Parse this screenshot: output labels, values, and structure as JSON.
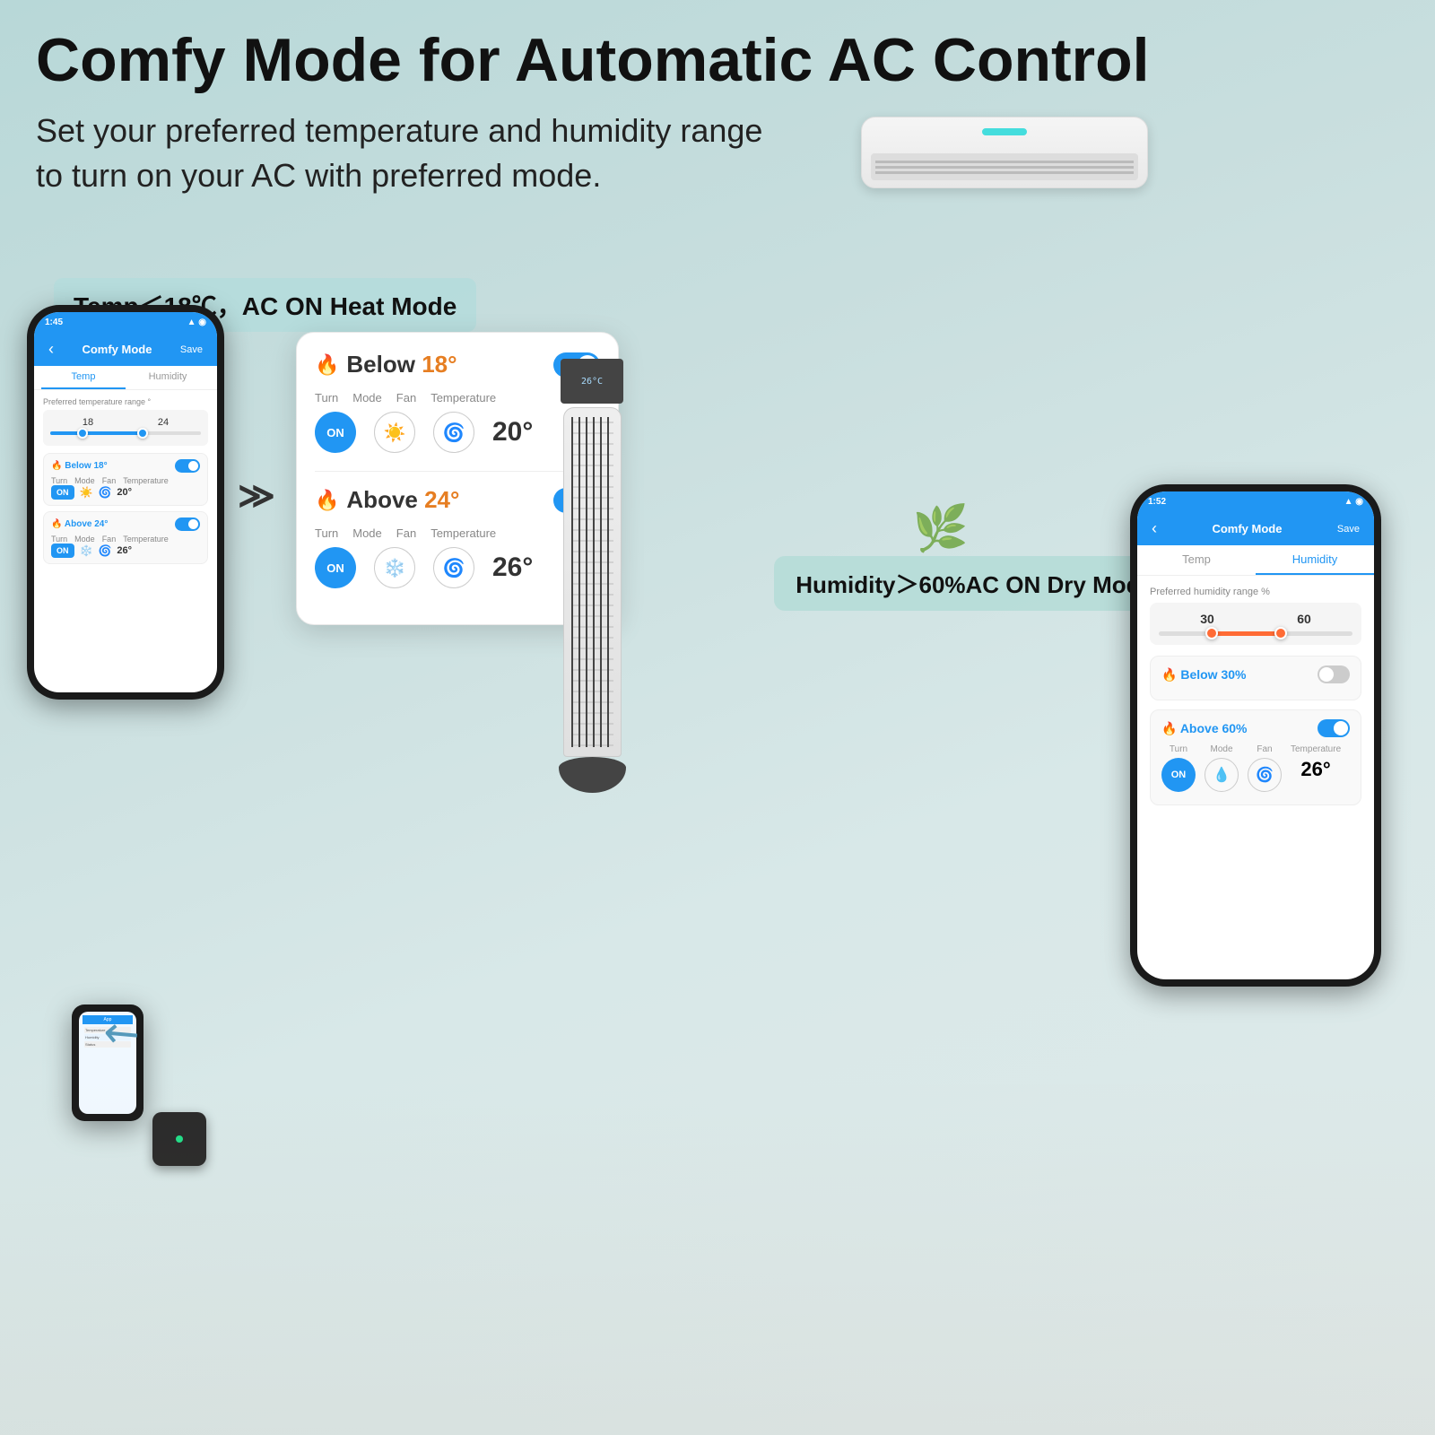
{
  "page": {
    "title": "Comfy Mode for Automatic AC Control",
    "subtitle_line1": "Set your preferred temperature and humidity range",
    "subtitle_line2": "to turn on your AC with preferred mode.",
    "temp_label": "Temp＜18℃，AC ON Heat Mode",
    "humidity_label": "Humidity＞60%AC ON Dry Mode"
  },
  "left_phone": {
    "time": "1:45",
    "nav_title": "Comfy Mode",
    "nav_save": "Save",
    "tab_temp": "Temp",
    "tab_humidity": "Humidity",
    "range_label": "Preferred temperature range °",
    "range_val1": "18",
    "range_val2": "24",
    "below_title": "Below 18°",
    "below_color": "#e67e22",
    "above_title": "Above 24°",
    "above_color": "#e67e22",
    "turn_label": "Turn",
    "mode_label": "Mode",
    "fan_label": "Fan",
    "temp_label": "Temperature",
    "below_temp": "20°",
    "above_temp": "26°",
    "btn_on": "ON"
  },
  "center_card": {
    "below_title": "Below",
    "below_value": "18°",
    "above_title": "Above",
    "above_value": "24°",
    "turn_label": "Turn",
    "mode_label": "Mode",
    "fan_label": "Fan",
    "temp_label": "Temperature",
    "below_temp": "20°",
    "above_temp": "26°",
    "btn_on": "ON"
  },
  "right_phone": {
    "time": "1:52",
    "nav_title": "Comfy Mode",
    "nav_save": "Save",
    "tab_temp": "Temp",
    "tab_humidity": "Humidity",
    "range_label": "Preferred humidity range %",
    "range_val1": "30",
    "range_val2": "60",
    "below_title": "Below 30%",
    "above_title": "Above 60%",
    "below_color": "#e67e22",
    "above_color": "#e67e22",
    "turn_label": "Turn",
    "mode_label": "Mode",
    "fan_label": "Fan",
    "temp_label": "Temperature",
    "above_temp": "26°",
    "btn_on": "ON"
  },
  "tower_display": "26°C",
  "icons": {
    "flame": "🔥",
    "sun": "☀️",
    "fan": "🌀",
    "snowflake": "❄️",
    "droplet": "💧",
    "arrow_double": "≫",
    "arrow_curved": "↗"
  }
}
